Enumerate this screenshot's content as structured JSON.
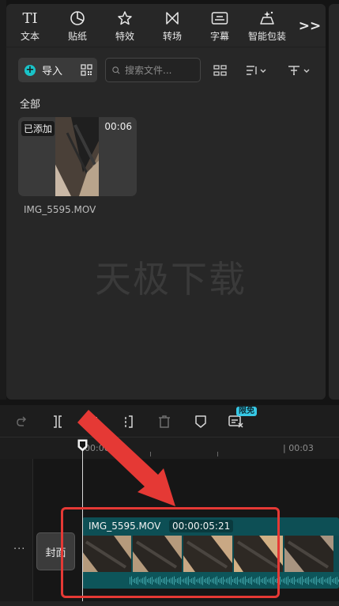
{
  "tabs": [
    {
      "label": "文本",
      "icon": "text-icon"
    },
    {
      "label": "贴纸",
      "icon": "sticker-icon"
    },
    {
      "label": "特效",
      "icon": "effects-star-icon"
    },
    {
      "label": "转场",
      "icon": "transition-icon"
    },
    {
      "label": "字幕",
      "icon": "subtitle-icon"
    },
    {
      "label": "智能包装",
      "icon": "smart-package-icon"
    }
  ],
  "tab_icon_text": "TI",
  "more_label": ">>",
  "toolbar": {
    "import_label": "导入",
    "search_placeholder": "搜索文件..."
  },
  "section_title": "全部",
  "media_item": {
    "added_label": "已添加",
    "duration": "00:06",
    "filename": "IMG_5595.MOV"
  },
  "watermark": "天极下载",
  "timeline": {
    "badge": "限免",
    "ruler_start": "00:00",
    "ruler_mark": "| 00:03",
    "cover_label": "封面",
    "more_dots": "···",
    "clip_name": "IMG_5595.MOV",
    "clip_duration": "00:00:05:21"
  },
  "colors": {
    "accent": "#19c3c8",
    "clip_teal": "#0d4a50",
    "annotation_red": "#e53935"
  }
}
